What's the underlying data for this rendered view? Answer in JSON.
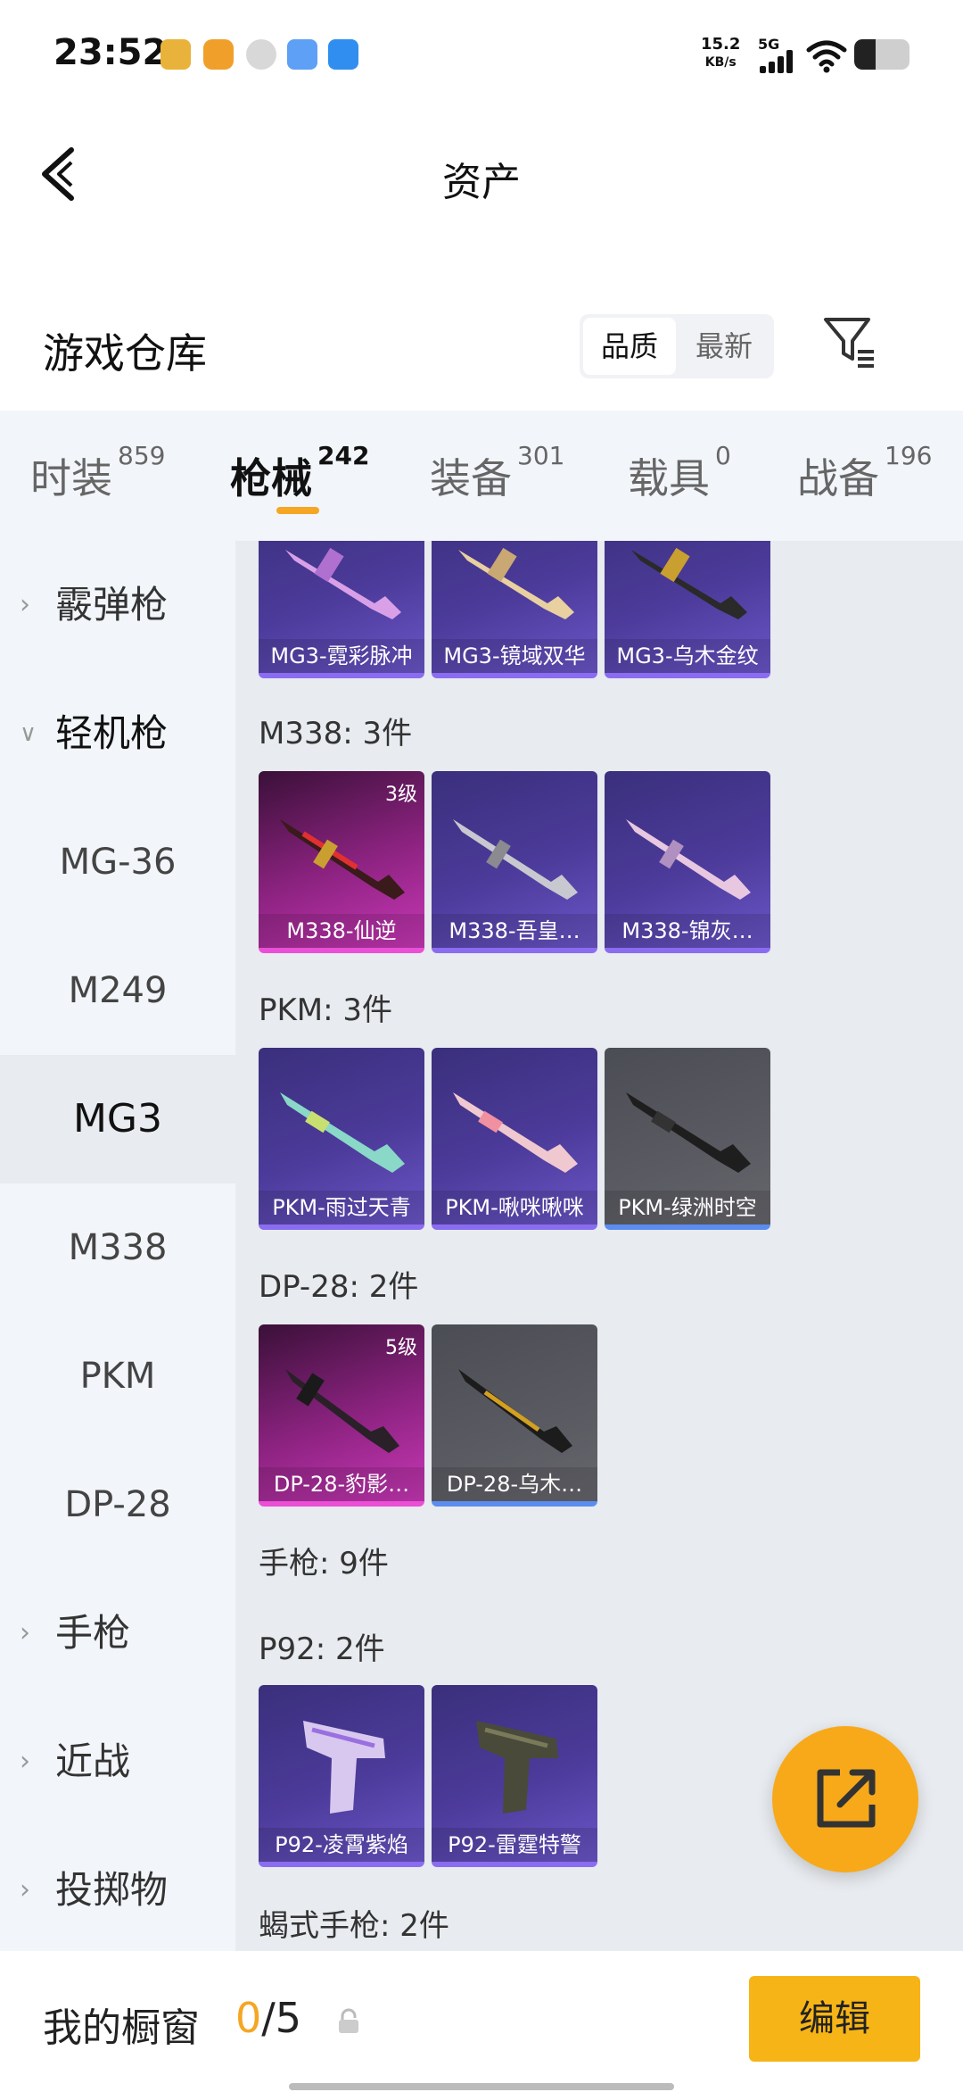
{
  "status_bar": {
    "time": "23:52",
    "net_speed_value": "15.2",
    "net_speed_unit": "KB/s",
    "network_type": "5G",
    "battery_level": 0.4
  },
  "header": {
    "title": "资产"
  },
  "warehouse": {
    "title": "游戏仓库",
    "sort_quality": "品质",
    "sort_newest": "最新"
  },
  "tabs": [
    {
      "label": "时装",
      "count": "859"
    },
    {
      "label": "枪械",
      "count": "242"
    },
    {
      "label": "装备",
      "count": "301"
    },
    {
      "label": "载具",
      "count": "0"
    },
    {
      "label": "战备",
      "count": "196"
    }
  ],
  "nav": {
    "shotgun": "霰弹枪",
    "lmg": "轻机枪",
    "mg36": "MG-36",
    "m249": "M249",
    "mg3": "MG3",
    "m338": "M338",
    "pkm": "PKM",
    "dp28": "DP-28",
    "pistol": "手枪",
    "melee": "近战",
    "throwable": "投掷物"
  },
  "groups": {
    "m338": "M338: 3件",
    "pkm": "PKM: 3件",
    "dp28": "DP-28: 2件",
    "pistol": "手枪: 9件",
    "p92": "P92: 2件",
    "scorpion": "蝎式手枪: 2件"
  },
  "cards": {
    "mg3_1": "MG3-霓彩脉冲",
    "mg3_2": "MG3-镜域双华",
    "mg3_3": "MG3-乌木金纹",
    "m338_1": "M338-仙逆",
    "m338_1_level": "3级",
    "m338_2": "M338-吾皇…",
    "m338_3": "M338-锦灰…",
    "pkm_1": "PKM-雨过天青",
    "pkm_2": "PKM-啾咪啾咪",
    "pkm_3": "PKM-绿洲时空",
    "dp28_1": "DP-28-豹影…",
    "dp28_1_level": "5级",
    "dp28_2": "DP-28-乌木…",
    "p92_1": "P92-凌霄紫焰",
    "p92_2": "P92-雷霆特警"
  },
  "showcase": {
    "label": "我的橱窗",
    "current": "0",
    "separator_total": "/5",
    "edit": "编辑"
  },
  "colors": {
    "accent": "#f5a623",
    "button": "#f7b416",
    "rarity_purple": "#8a6cf0",
    "rarity_pink": "#ea4fd6",
    "rarity_blue": "#5b8df0"
  }
}
